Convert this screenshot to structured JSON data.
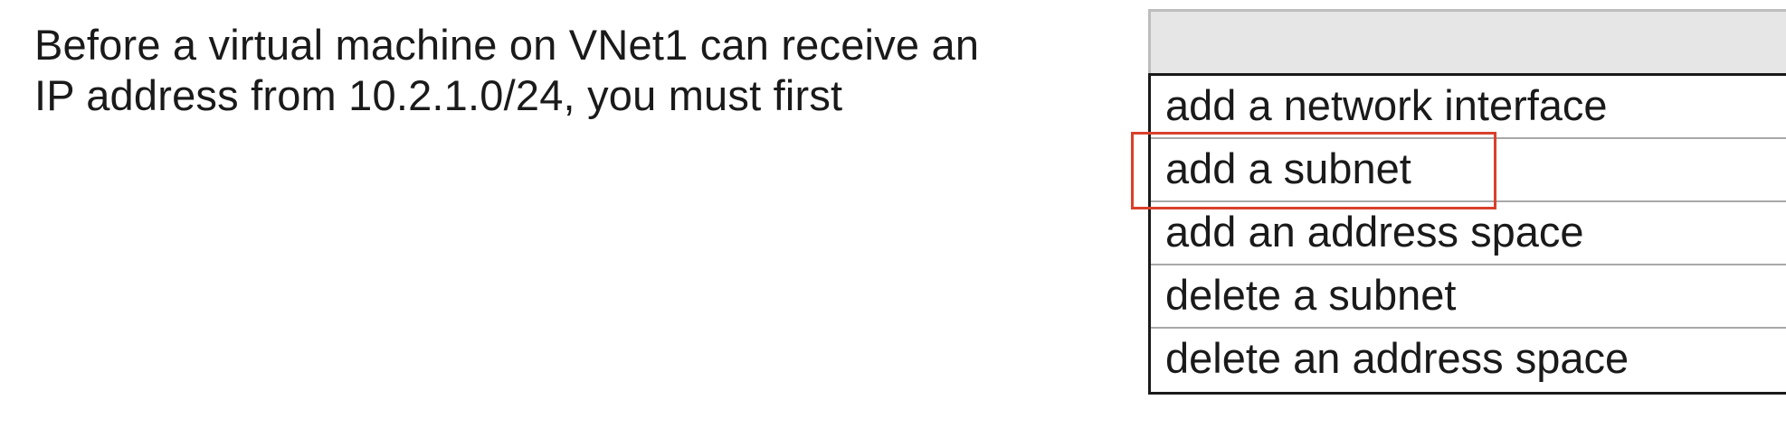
{
  "question": {
    "line1": "Before a virtual machine on VNet1 can receive an",
    "line2": "IP address from 10.2.1.0/24, you must first"
  },
  "dropdown": {
    "selected": "",
    "options": [
      "add a network interface",
      "add a subnet",
      "add an address space",
      "delete a subnet",
      "delete an address space"
    ],
    "highlighted_option": "add a subnet"
  },
  "colors": {
    "highlight_border": "#d9402b",
    "dropdown_header_bg": "#e6e6e6"
  }
}
